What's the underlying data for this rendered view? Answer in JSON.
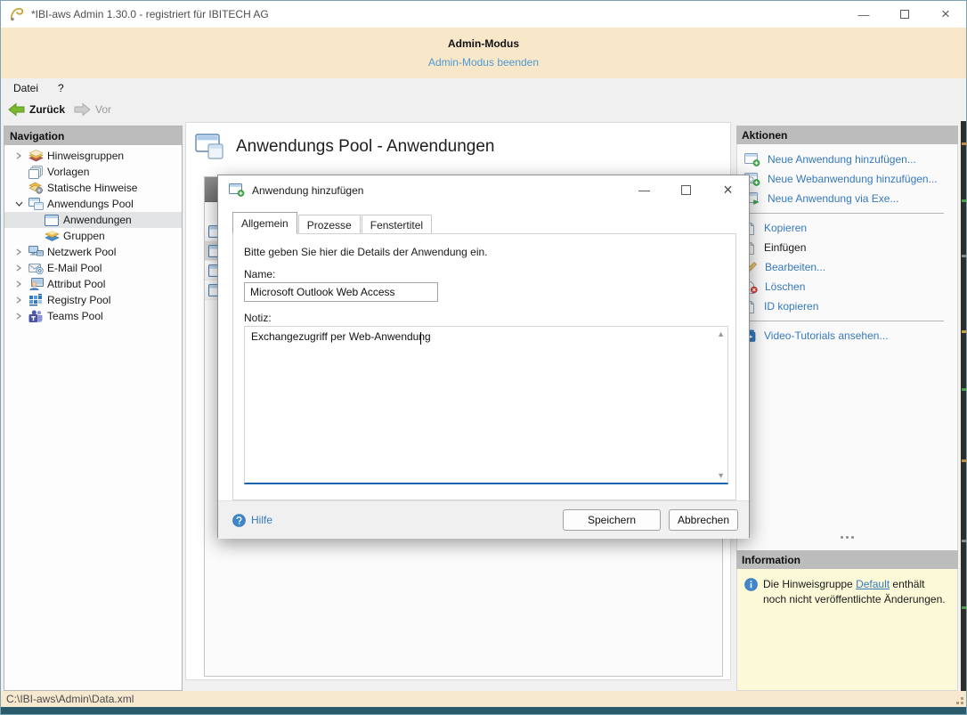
{
  "window": {
    "title": "*IBI-aws Admin 1.30.0 - registriert für IBITECH AG"
  },
  "icons": {
    "minimize_glyph": "—",
    "close_glyph": "×"
  },
  "banner": {
    "title": "Admin-Modus",
    "link": "Admin-Modus beenden"
  },
  "menu": {
    "items": [
      {
        "label": "Datei"
      },
      {
        "label": "?"
      }
    ]
  },
  "toolbar": {
    "back_label": "Zurück",
    "forward_label": "Vor"
  },
  "navigation": {
    "header": "Navigation",
    "items": [
      {
        "label": "Hinweisgruppen"
      },
      {
        "label": "Vorlagen"
      },
      {
        "label": "Statische Hinweise"
      },
      {
        "label": "Anwendungs Pool"
      },
      {
        "label": "Anwendungen",
        "selected": true
      },
      {
        "label": "Gruppen"
      },
      {
        "label": "Netzwerk Pool"
      },
      {
        "label": "E-Mail Pool"
      },
      {
        "label": "Attribut Pool"
      },
      {
        "label": "Registry Pool"
      },
      {
        "label": "Teams Pool"
      }
    ]
  },
  "main": {
    "title": "Anwendungs Pool - Anwendungen"
  },
  "dialog": {
    "title": "Anwendung hinzufügen",
    "tabs": [
      {
        "label": "Allgemein"
      },
      {
        "label": "Prozesse"
      },
      {
        "label": "Fenstertitel"
      }
    ],
    "description": "Bitte geben Sie hier die Details der Anwendung ein.",
    "name_label": "Name:",
    "name_value": "Microsoft Outlook Web Access",
    "note_label": "Notiz:",
    "note_value": "Exchangezugriff per Web-Anwendung",
    "help_label": "Hilfe",
    "save_label": "Speichern",
    "cancel_label": "Abbrechen"
  },
  "actions": {
    "header": "Aktionen",
    "items": [
      {
        "label": "Neue Anwendung hinzufügen..."
      },
      {
        "label": "Neue Webanwendung hinzufügen..."
      },
      {
        "label": "Neue Anwendung via Exe..."
      },
      {
        "label": "Kopieren"
      },
      {
        "label": "Einfügen",
        "disabled": true
      },
      {
        "label": "Bearbeiten..."
      },
      {
        "label": "Löschen"
      },
      {
        "label": "ID kopieren"
      },
      {
        "label": "Video-Tutorials ansehen..."
      }
    ]
  },
  "information": {
    "header": "Information",
    "text_before": "Die Hinweisgruppe ",
    "link": "Default",
    "text_after": " enthält noch nicht veröffentlichte Änderungen."
  },
  "statusbar": {
    "path": "C:\\IBI-aws\\Admin\\Data.xml"
  }
}
